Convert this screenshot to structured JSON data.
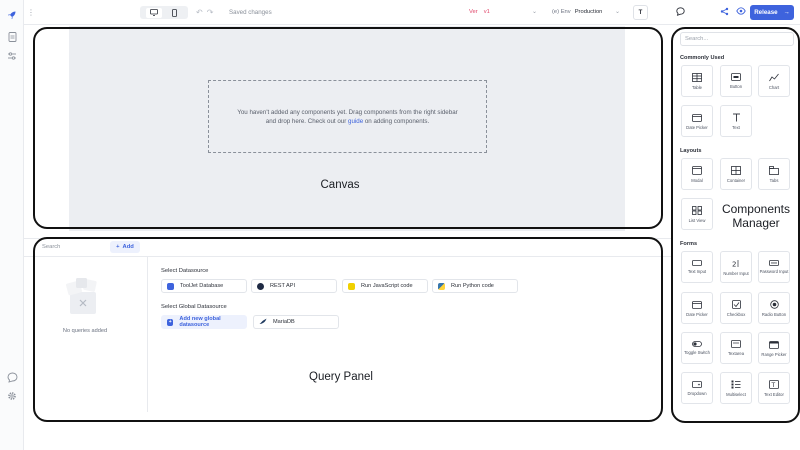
{
  "toolbar": {
    "saved_status": "Saved changes",
    "version_label": "Ver",
    "version_value": "v1",
    "env_label": "(e) Env",
    "env_value": "Production",
    "theme_button": "T",
    "release_label": "Release"
  },
  "canvas": {
    "empty_text_before": "You haven't added any components yet. Drag components from the right sidebar and drop here. Check out our ",
    "empty_link": "guide",
    "empty_text_after": " on adding components.",
    "label": "Canvas"
  },
  "query_panel": {
    "search_placeholder": "Search",
    "add_label": "Add",
    "no_queries": "No queries added",
    "select_datasource": "Select Datasource",
    "select_global": "Select Global Datasource",
    "datasources": [
      "ToolJet Database",
      "REST API",
      "Run JavaScript code",
      "Run Python code"
    ],
    "global_datasources": [
      "Add new global datasource",
      "MariaDB"
    ],
    "label": "Query Panel"
  },
  "components": {
    "search_placeholder": "Search...",
    "sections": {
      "commonly_used": "Commonly Used",
      "layouts": "Layouts",
      "forms": "Forms"
    },
    "commonly_used": [
      "Table",
      "Button",
      "Chart",
      "Date Picker",
      "Text"
    ],
    "layouts": [
      "Modal",
      "Container",
      "Tabs",
      "List View"
    ],
    "forms": [
      "Text Input",
      "Number Input",
      "Password Input",
      "Date Picker",
      "Checkbox",
      "Radio Button",
      "Toggle Switch",
      "Textarea",
      "Range Picker",
      "Dropdown",
      "Multiselect",
      "Text Editor"
    ],
    "label": "Components Manager"
  }
}
